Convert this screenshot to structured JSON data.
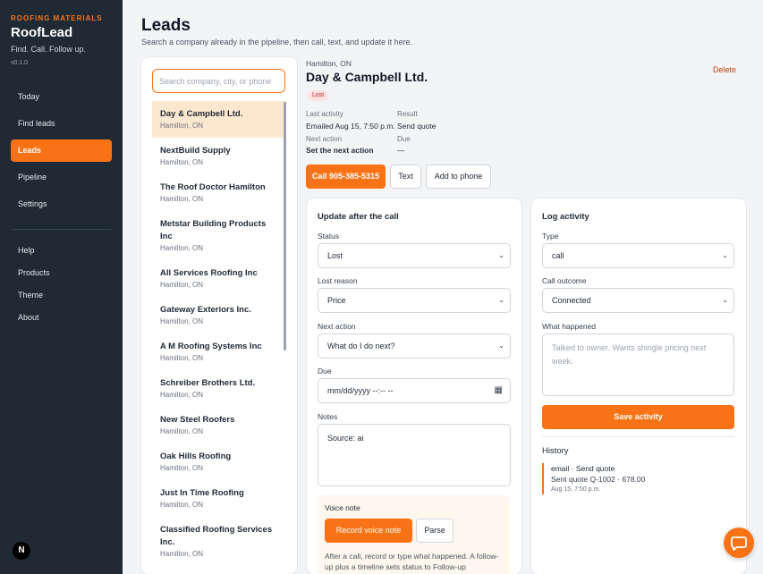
{
  "sidebar": {
    "eyebrow": "ROOFING MATERIALS",
    "app_name": "RoofLead",
    "tagline": "Find. Call. Follow up.",
    "version": "v0.1.0",
    "nav": [
      "Today",
      "Find leads",
      "Leads",
      "Pipeline",
      "Settings"
    ],
    "active": "Leads",
    "secondary": [
      "Help",
      "Products",
      "Theme",
      "About"
    ],
    "badge": "N"
  },
  "header": {
    "title": "Leads",
    "subtitle": "Search a company already in the pipeline, then call, text, and update it here."
  },
  "search": {
    "placeholder": "Search company, city, or phone"
  },
  "companies": [
    {
      "name": "Day & Campbell Ltd.",
      "city": "Hamilton, ON"
    },
    {
      "name": "NextBuild Supply",
      "city": "Hamilton, ON"
    },
    {
      "name": "The Roof Doctor Hamilton",
      "city": "Hamilton, ON"
    },
    {
      "name": "Metstar Building Products Inc",
      "city": "Hamilton, ON"
    },
    {
      "name": "All Services Roofing Inc",
      "city": "Hamilton, ON"
    },
    {
      "name": "Gateway Exteriors Inc.",
      "city": "Hamilton, ON"
    },
    {
      "name": "A M Roofing Systems Inc",
      "city": "Hamilton, ON"
    },
    {
      "name": "Schreiber Brothers Ltd.",
      "city": "Hamilton, ON"
    },
    {
      "name": "New Steel Roofers",
      "city": "Hamilton, ON"
    },
    {
      "name": "Oak Hills Roofing",
      "city": "Hamilton, ON"
    },
    {
      "name": "Just In Time Roofing",
      "city": "Hamilton, ON"
    },
    {
      "name": "Classified Roofing Services Inc.",
      "city": "Hamilton, ON"
    }
  ],
  "lead": {
    "city": "Hamilton, ON",
    "name": "Day & Campbell Ltd.",
    "status_badge": "Lost",
    "delete_label": "Delete",
    "last_activity_label": "Last activity",
    "last_activity": "Emailed Aug 15, 7:50 p.m.",
    "result_label": "Result",
    "result": "Send quote",
    "next_action_label": "Next action",
    "next_action": "Set the next action",
    "due_label": "Due",
    "due": "—"
  },
  "actions": {
    "call": "Call 905-385-5315",
    "text": "Text",
    "add_to_phone": "Add to phone"
  },
  "update": {
    "title": "Update after the call",
    "status_label": "Status",
    "status": "Lost",
    "lost_reason_label": "Lost reason",
    "lost_reason": "Price",
    "next_action_label": "Next action",
    "next_action": "What do I do next?",
    "due_label": "Due",
    "due_placeholder": "mm/dd/yyyy --:-- --",
    "notes_label": "Notes",
    "notes": "Source: ai",
    "voice_title": "Voice note",
    "record_label": "Record voice note",
    "parse_label": "Parse",
    "voice_help": "After a call, record or type what happened. A follow-up plus a timeline sets status to Follow-up"
  },
  "log": {
    "title": "Log activity",
    "type_label": "Type",
    "type": "call",
    "outcome_label": "Call outcome",
    "outcome": "Connected",
    "what_label": "What happened",
    "what_placeholder": "Talked to owner. Wants shingle pricing next week.",
    "save_label": "Save activity",
    "history_title": "History",
    "history": [
      {
        "title": "email · Send quote",
        "detail": "Sent quote Q-1002 · 678.00",
        "time": "Aug 15, 7:50 p.m."
      }
    ]
  },
  "colors": {
    "accent": "#f97316",
    "sidebar": "#1f2a35",
    "selected": "#fde8cf"
  }
}
